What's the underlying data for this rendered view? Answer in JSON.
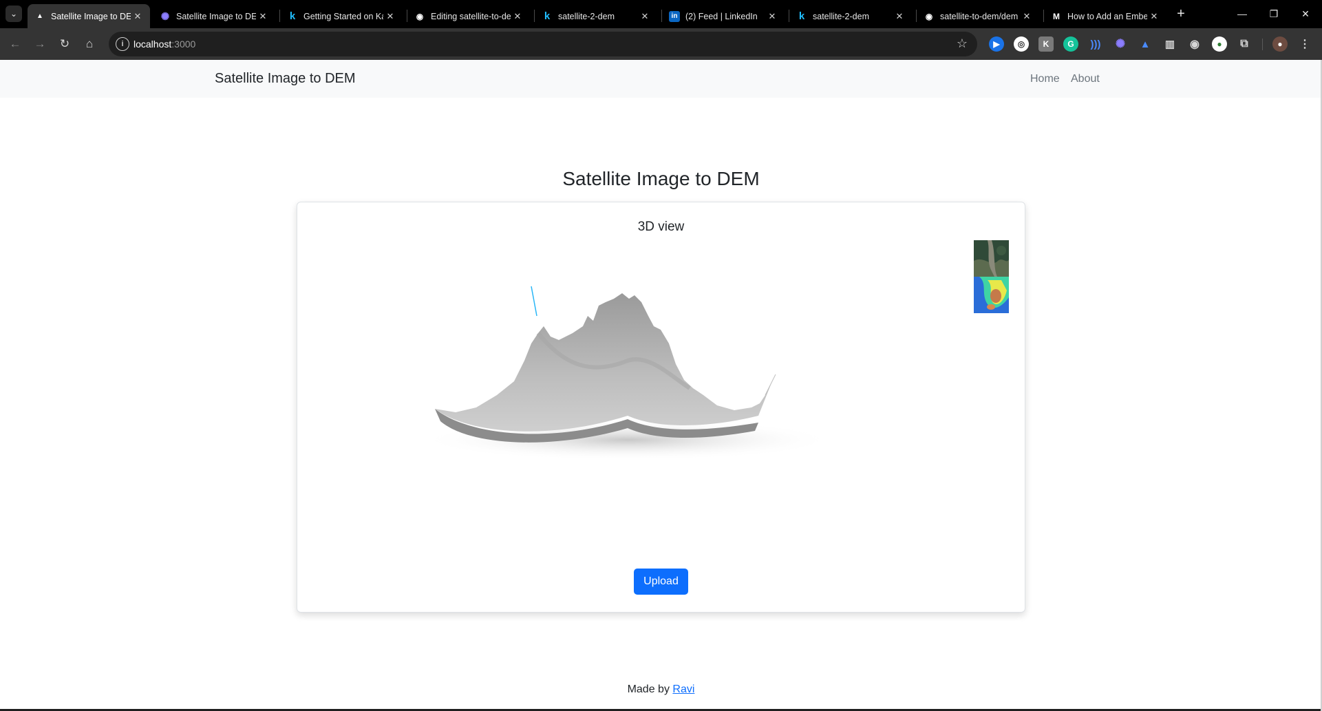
{
  "browser": {
    "tabs": [
      {
        "title": "Satellite Image to DEM",
        "icon": "triangle-icon",
        "glyph": "▲",
        "color": "#ffffff",
        "active": true
      },
      {
        "title": "Satellite Image to DEM",
        "icon": "starburst-icon",
        "glyph": "✺",
        "color": "#8b7dff",
        "active": false
      },
      {
        "title": "Getting Started on Kaggle",
        "icon": "kaggle-icon",
        "glyph": "k",
        "color": "#20beff",
        "active": false
      },
      {
        "title": "Editing satellite-to-dem",
        "icon": "github-icon",
        "glyph": "◉",
        "color": "#ffffff",
        "active": false
      },
      {
        "title": "satellite-2-dem",
        "icon": "kaggle-icon",
        "glyph": "k",
        "color": "#20beff",
        "active": false
      },
      {
        "title": "(2) Feed | LinkedIn",
        "icon": "linkedin-icon",
        "glyph": "in",
        "color": "#0a66c2",
        "active": false
      },
      {
        "title": "satellite-2-dem",
        "icon": "kaggle-icon",
        "glyph": "k",
        "color": "#20beff",
        "active": false
      },
      {
        "title": "satellite-to-dem/dem",
        "icon": "github-icon",
        "glyph": "◉",
        "color": "#ffffff",
        "active": false
      },
      {
        "title": "How to Add an Embed",
        "icon": "medium-icon",
        "glyph": "M",
        "color": "#ffffff",
        "active": false
      }
    ],
    "url_host": "localhost",
    "url_port": ":3000"
  },
  "navbar": {
    "brand": "Satellite Image to DEM",
    "links": [
      "Home",
      "About"
    ]
  },
  "main": {
    "title": "Satellite Image to DEM",
    "card_title": "3D view",
    "upload_label": "Upload"
  },
  "footer": {
    "prefix": "Made by ",
    "author": "Ravi"
  },
  "colors": {
    "primary": "#0d6efd",
    "navbar_bg": "#f8f9fa",
    "terrain": "#b8b8b8"
  }
}
